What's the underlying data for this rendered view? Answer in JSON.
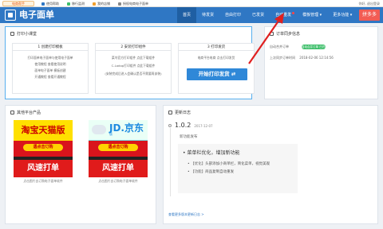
{
  "topbar": {
    "logo": "电商帮手",
    "links": [
      {
        "label": "使用帮助",
        "color": "#2f77c4"
      },
      {
        "label": "移行监测",
        "color": "#3fbf6b"
      },
      {
        "label": "我的店铺",
        "color": "#f0a030"
      },
      {
        "label": "授权电商电子面单",
        "color": "#888888"
      }
    ],
    "right": "你好,  退出登录"
  },
  "header": {
    "title": "电子面单",
    "nav": [
      {
        "label": "首页",
        "active": true
      },
      {
        "label": "待发货",
        "active": false
      },
      {
        "label": "自由打印",
        "active": false
      },
      {
        "label": "已发货",
        "active": false
      },
      {
        "label": "自动重发",
        "active": false
      },
      {
        "label": "模板管理 ▾",
        "active": false
      },
      {
        "label": "更多功能 ▾",
        "active": false
      }
    ],
    "cta": "拼多多"
  },
  "course": {
    "title": "打印小课堂",
    "steps": [
      {
        "heading": "1 创建打印模板",
        "lines": [
          "打印面单电子面单与使用电子面单",
          "使用教程 查看使用说明",
          "面单电子面单 模板创建",
          "开通教程 查看开通教程"
        ]
      },
      {
        "heading": "2 安装打印组件",
        "lines": [
          "菜鸟官方打印组件 点此下载组件",
          "C-Lodop打印组件 点此下载组件",
          "(安装完成后进入会确认是否不需要再安装)"
        ]
      },
      {
        "heading": "3 打印发货",
        "lines": [
          "电商平台电商 点击打印发货"
        ],
        "button": "开始打印发货 ⇄"
      }
    ]
  },
  "order": {
    "title": "订单同步信息",
    "auto_label": "自动合并订单",
    "toggle": "自动合并订单 已开启",
    "sync_label": "上次同步订单时间",
    "sync_time": "2018-02-06 12:14:56"
  },
  "products": {
    "title": "其他平台产品",
    "items": [
      {
        "banner": "淘宝天猫版",
        "pill": "遇点击订购",
        "fast": "风速打单",
        "caption": "点击图片去订购电子面单软件"
      },
      {
        "banner": "JD.京东",
        "banner_sub": "版",
        "pill": "遇点击订购",
        "fast": "风速打单",
        "caption": "点击图片去订购电子面单软件"
      }
    ]
  },
  "changelog": {
    "title": "更新日志",
    "version": "1.0.2",
    "date": "2017-12-07",
    "subtitle": "新功能发布",
    "box_heading": "• 菜单栏优化，增加新功能",
    "items": [
      {
        "tag": "【优化】",
        "text": "头部添加小商单栏，简化菜单，视觉美观"
      },
      {
        "tag": "【功能】",
        "text": "商品复制自动重发"
      }
    ],
    "more": "查看更多版本更新日志 >"
  },
  "colors": {
    "header_bg": "#2f77c4",
    "cta_bg": "#f25c54",
    "accent_green": "#3fbf6b",
    "annotation_red": "#e02020"
  }
}
